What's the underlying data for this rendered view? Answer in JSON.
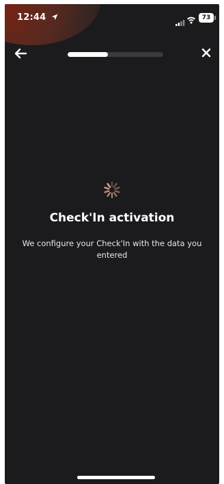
{
  "status_bar": {
    "time": "12:44",
    "battery": "73",
    "icons": [
      "location-arrow-icon",
      "signal-icon",
      "wifi-icon",
      "battery-icon"
    ]
  },
  "nav": {
    "back_icon": "arrow-left-icon",
    "close_icon": "close-icon",
    "progress_fraction": 0.42
  },
  "loader": {
    "icon": "spinner-icon",
    "title": "Check'In activation",
    "subtitle": "We configure your Check'In with the data you entered"
  },
  "colors": {
    "background": "#1b1b1d",
    "text": "#ffffff",
    "progress_track": "#3a3a3d",
    "progress_fill": "#ffffff",
    "spinner_accent": "#e8a48c"
  }
}
